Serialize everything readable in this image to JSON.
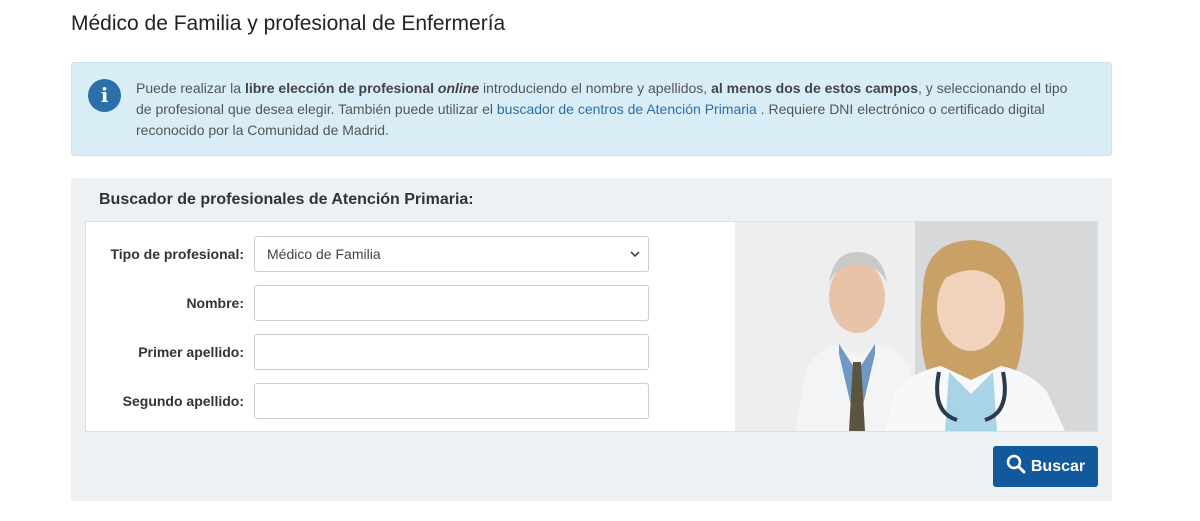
{
  "page": {
    "title": "Médico de Familia y profesional de Enfermería"
  },
  "info": {
    "icon": "info-icon",
    "t1": "Puede realizar la ",
    "b1": "libre elección de profesional ",
    "i1": "online",
    "t2": " introduciendo el nombre y apellidos, ",
    "b2": "al menos dos de estos campos",
    "t3": ", y seleccionando el tipo de profesional que desea elegir. También puede utilizar el ",
    "link": "buscador de centros de Atención Primaria",
    "t4": " . Requiere DNI electrónico o certificado digital reconocido por la Comunidad de Madrid."
  },
  "search": {
    "title": "Buscador de profesionales de Atención Primaria:",
    "tipo_label": "Tipo de profesional:",
    "tipo_value": "Médico de Familia",
    "nombre_label": "Nombre:",
    "nombre_value": "",
    "apellido1_label": "Primer apellido:",
    "apellido1_value": "",
    "apellido2_label": "Segundo apellido:",
    "apellido2_value": "",
    "button_label": "Buscar",
    "button_icon": "search-icon"
  },
  "colors": {
    "info_bg": "#d9edf7",
    "link": "#2a6fa8",
    "button": "#11599c",
    "panel_bg": "#eef1f4"
  }
}
